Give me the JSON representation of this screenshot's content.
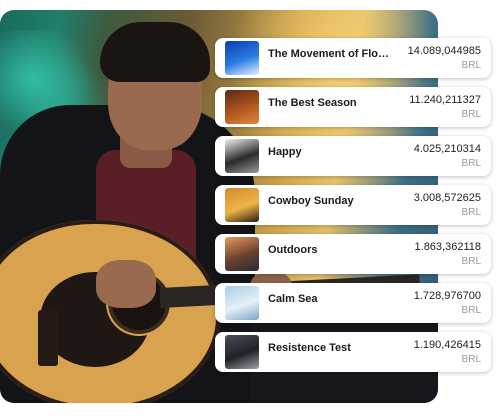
{
  "tracks": [
    {
      "title": "The Movement of Flowe...",
      "value": "14.089,044985",
      "currency": "BRL",
      "thumb_colors": [
        "#0b3fb0",
        "#2a7de0",
        "#e8f1ff"
      ]
    },
    {
      "title": "The Best Season",
      "value": "11.240,211327",
      "currency": "BRL",
      "thumb_colors": [
        "#5a2a12",
        "#b0561f",
        "#e08a3a"
      ]
    },
    {
      "title": "Happy",
      "value": "4.025,210314",
      "currency": "BRL",
      "thumb_colors": [
        "#f2f2f2",
        "#2b2b2b",
        "#9a9a9a"
      ]
    },
    {
      "title": "Cowboy Sunday",
      "value": "3.008,572625",
      "currency": "BRL",
      "thumb_colors": [
        "#d08a2e",
        "#f0b44a",
        "#2a1a10"
      ]
    },
    {
      "title": "Outdoors",
      "value": "1.863,362118",
      "currency": "BRL",
      "thumb_colors": [
        "#e89a5a",
        "#6a4030",
        "#2a2a34"
      ]
    },
    {
      "title": "Calm Sea",
      "value": "1.728,976700",
      "currency": "BRL",
      "thumb_colors": [
        "#a9cde8",
        "#e6f0f7",
        "#7aa6c8"
      ]
    },
    {
      "title": "Resistence Test",
      "value": "1.190,426415",
      "currency": "BRL",
      "thumb_colors": [
        "#4a5058",
        "#1e2226",
        "#9aa0a8"
      ]
    }
  ]
}
